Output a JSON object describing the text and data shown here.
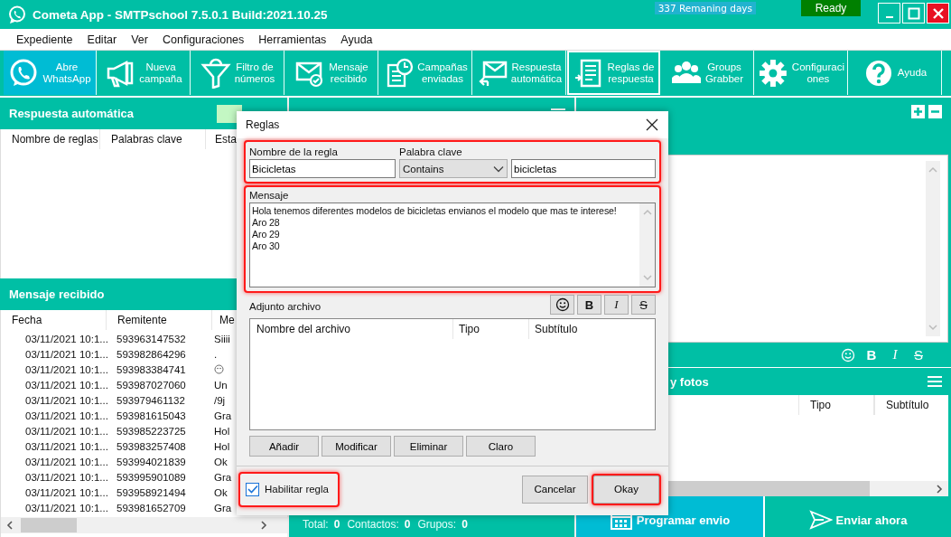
{
  "window": {
    "title": "Cometa App - SMTPschool 7.5.0.1 Build:2021.10.25",
    "days_badge": "337 Remaning days",
    "status": "Ready"
  },
  "menu": [
    "Expediente",
    "Editar",
    "Ver",
    "Configuraciones",
    "Herramientas",
    "Ayuda"
  ],
  "toolbar": [
    {
      "kind": "whatsapp",
      "label": "Abre\nWhatsApp",
      "selected": true,
      "outlined": false
    },
    {
      "kind": "megaphone",
      "label": "Nueva\ncampaña",
      "selected": false,
      "outlined": false
    },
    {
      "kind": "funnel",
      "label": "Filtro de\nnúmeros",
      "selected": false,
      "outlined": false
    },
    {
      "kind": "mail-check",
      "label": "Mensaje\nrecibido",
      "selected": false,
      "outlined": false
    },
    {
      "kind": "notebook",
      "label": "Campañas\nenviadas",
      "selected": false,
      "outlined": false
    },
    {
      "kind": "mail-reply",
      "label": "Respuesta\nautomática",
      "selected": false,
      "outlined": false
    },
    {
      "kind": "document",
      "label": "Reglas de\nrespuesta",
      "selected": false,
      "outlined": true
    },
    {
      "kind": "people",
      "label": "Groups\nGrabber",
      "selected": false,
      "outlined": false
    },
    {
      "kind": "gear",
      "label": "Configuraci\nones",
      "selected": false,
      "outlined": false
    },
    {
      "kind": "help",
      "label": "Ayuda",
      "selected": false,
      "outlined": false
    }
  ],
  "rules_panel": {
    "title": "Respuesta automática",
    "columns": [
      "Nombre de reglas",
      "Palabras clave",
      "Esta"
    ]
  },
  "received_panel": {
    "title": "Mensaje recibido",
    "columns": [
      "Fecha",
      "Remitente",
      "Me"
    ],
    "rows": [
      {
        "date": "03/11/2021 10:1...",
        "sender": "593963147532",
        "message": "Siiii",
        "emoji": false
      },
      {
        "date": "03/11/2021 10:1...",
        "sender": "593982864296",
        "message": ".",
        "emoji": false
      },
      {
        "date": "03/11/2021 10:1...",
        "sender": "593983384741",
        "message": "",
        "emoji": true
      },
      {
        "date": "03/11/2021 10:1...",
        "sender": "593987027060",
        "message": "Un",
        "emoji": false
      },
      {
        "date": "03/11/2021 10:1...",
        "sender": "593979461132",
        "message": "/9j",
        "emoji": false
      },
      {
        "date": "03/11/2021 10:1...",
        "sender": "593981615043",
        "message": "Gra",
        "emoji": false
      },
      {
        "date": "03/11/2021 10:1...",
        "sender": "593985223725",
        "message": "Hol",
        "emoji": false
      },
      {
        "date": "03/11/2021 10:1...",
        "sender": "593983257408",
        "message": "Hol",
        "emoji": false
      },
      {
        "date": "03/11/2021 10:1...",
        "sender": "593994021839",
        "message": "Ok",
        "emoji": false
      },
      {
        "date": "03/11/2021 10:1...",
        "sender": "593995901089",
        "message": "Gra",
        "emoji": false
      },
      {
        "date": "03/11/2021 10:1...",
        "sender": "593958921494",
        "message": "Ok",
        "emoji": false
      },
      {
        "date": "03/11/2021 10:1...",
        "sender": "593981652709",
        "message": "Gra",
        "emoji": false
      }
    ]
  },
  "numbers_panel": {
    "totals": [
      {
        "label": "Total:",
        "value": "0"
      },
      {
        "label": "Contactos:",
        "value": "0"
      },
      {
        "label": "Grupos:",
        "value": "0"
      }
    ]
  },
  "message_panel": {
    "format_buttons": [
      {
        "kind": "emoji"
      },
      {
        "kind": "bold",
        "label": "B"
      },
      {
        "kind": "italic",
        "label": "I"
      },
      {
        "kind": "strike",
        "label": "S"
      }
    ],
    "media_title": "y fotos",
    "media_columns": [
      "Tipo",
      "Subtítulo"
    ]
  },
  "actions": [
    {
      "kind": "calendar",
      "label": "Programar envio"
    },
    {
      "kind": "send",
      "label": "Enviar ahora"
    }
  ],
  "dialog": {
    "title": "Reglas",
    "fields_highlighted": true,
    "rule_name_label": "Nombre de la regla",
    "rule_name": "Bicicletas",
    "keyword_label": "Palabra clave",
    "match_mode": "Contains",
    "keyword": "bicicletas",
    "message_label": "Mensaje",
    "message_highlighted": true,
    "message": "Hola tenemos diferentes modelos de bicicletas envianos el modelo que mas te interese!\nAro 28\nAro 29\nAro 30",
    "format_buttons": [
      {
        "kind": "emoji"
      },
      {
        "kind": "bold",
        "label": "B"
      },
      {
        "kind": "italic",
        "label": "I"
      },
      {
        "kind": "strike",
        "label": "S"
      }
    ],
    "attachment_label": "Adjunto archivo",
    "attachment_columns": [
      "Nombre del archivo",
      "Tipo",
      "Subtítulo"
    ],
    "attachment_buttons": [
      "Añadir",
      "Modificar",
      "Eliminar",
      "Claro"
    ],
    "enable": {
      "label": "Habilitar regla",
      "checked": true,
      "highlighted": true
    },
    "buttons": [
      {
        "label": "Cancelar",
        "highlighted": false
      },
      {
        "label": "Okay",
        "highlighted": true
      }
    ]
  }
}
